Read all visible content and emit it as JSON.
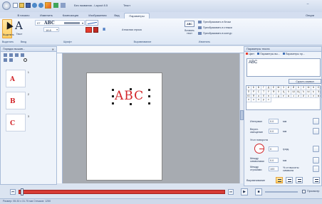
{
  "window": {
    "title": "Без названия - Layout 8.5",
    "context_tab": "Текст",
    "help_label": "Опции"
  },
  "ribbon": {
    "tabs": [
      "В начало",
      "Изменить",
      "Композиция",
      "Изображения",
      "Вид",
      "Параметры"
    ],
    "active_tab": "Параметры",
    "font_name": "ABC",
    "font_size": "18.8",
    "select_label": "Выделить",
    "text_label": "Текст",
    "outline_label": "Атласная строка",
    "insert_label": "Вставить текст",
    "convert_block": "Преобразовать в блоки",
    "convert_lines": "Преобразовать в стежки",
    "convert_contour": "Преобразовать в контур",
    "groups": [
      "Выделить",
      "Ввод",
      "Шрифт",
      "Выравнивание",
      "Изменить"
    ],
    "abc_small": "ABC"
  },
  "left_panel": {
    "title": "Порядок вышив...",
    "items": [
      {
        "letter": "A",
        "num": "1"
      },
      {
        "letter": "B",
        "num": "2"
      },
      {
        "letter": "C",
        "num": "3"
      }
    ]
  },
  "canvas": {
    "text": "ABC",
    "text_color": "#d2262a"
  },
  "right_panel": {
    "title": "Параметры текста",
    "tabs": [
      "Цвет",
      "Параметры вы...",
      "Параметры пр..."
    ],
    "text_value": "ABC",
    "hide_symbols": "Скрыть символ",
    "interval_label": "Интервал",
    "interval_value": "0.0",
    "vertical_label": "Верхн. смещение",
    "vertical_value": "0.0",
    "unit_mm": "мм",
    "rotation_label": "Угол поворота",
    "rotation_value": "0",
    "unit_deg": "град.",
    "line_spacing_label": "Между символами",
    "line_spacing_value": "0.0",
    "line_between_label": "Между строками",
    "line_between_value": "100",
    "line_between_unit": "% от высоты символа",
    "alignment_label": "Выравнивание",
    "grid_chars": [
      "A",
      "Б",
      "В",
      "Г",
      "Д",
      "Е",
      "Ж",
      "З",
      "И",
      "Й",
      "К",
      "Л",
      "М",
      "Н",
      "О",
      "П",
      "Р",
      "С",
      "Т",
      "У",
      "Ф",
      "Х",
      "Ц",
      "Ч",
      "Ш",
      "Щ",
      "Ъ",
      "Ы",
      "Ь",
      "Э",
      "Ю",
      "Я",
      "а",
      "б",
      "в",
      "г",
      "д",
      "е",
      "ж",
      "з",
      "и",
      "й",
      "к",
      "л",
      "м",
      "н",
      "о",
      "п",
      "р",
      "с"
    ]
  },
  "timeline": {
    "play_label": "Просмотр",
    "status_text": "Размер: 55.30 x 31.75 мм  Стежков: 1250"
  },
  "colors": {
    "accent": "#d2262a",
    "panel": "#eef3fa",
    "canvas_bg": "#a7abb1"
  }
}
